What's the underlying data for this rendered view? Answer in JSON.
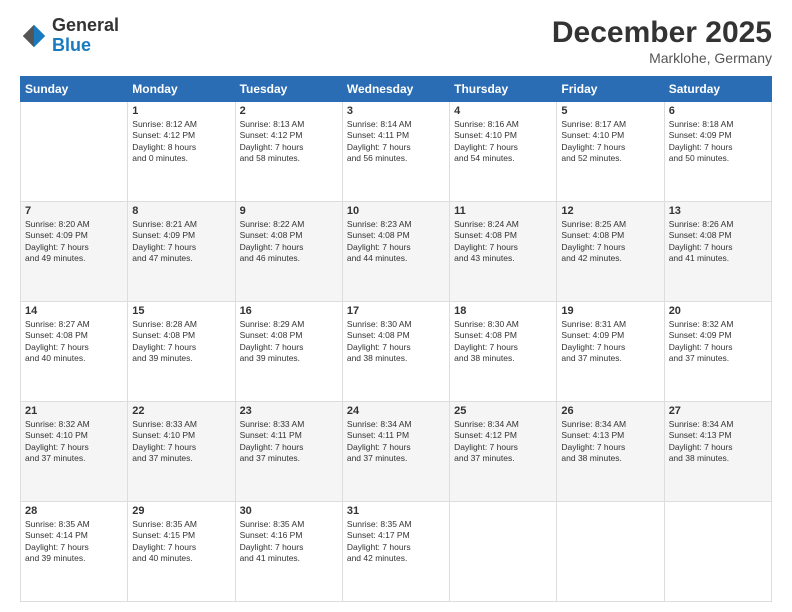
{
  "header": {
    "logo": {
      "general": "General",
      "blue": "Blue"
    },
    "title": "December 2025",
    "location": "Marklohe, Germany"
  },
  "days_of_week": [
    "Sunday",
    "Monday",
    "Tuesday",
    "Wednesday",
    "Thursday",
    "Friday",
    "Saturday"
  ],
  "weeks": [
    [
      {
        "day": "",
        "info": ""
      },
      {
        "day": "1",
        "info": "Sunrise: 8:12 AM\nSunset: 4:12 PM\nDaylight: 8 hours\nand 0 minutes."
      },
      {
        "day": "2",
        "info": "Sunrise: 8:13 AM\nSunset: 4:12 PM\nDaylight: 7 hours\nand 58 minutes."
      },
      {
        "day": "3",
        "info": "Sunrise: 8:14 AM\nSunset: 4:11 PM\nDaylight: 7 hours\nand 56 minutes."
      },
      {
        "day": "4",
        "info": "Sunrise: 8:16 AM\nSunset: 4:10 PM\nDaylight: 7 hours\nand 54 minutes."
      },
      {
        "day": "5",
        "info": "Sunrise: 8:17 AM\nSunset: 4:10 PM\nDaylight: 7 hours\nand 52 minutes."
      },
      {
        "day": "6",
        "info": "Sunrise: 8:18 AM\nSunset: 4:09 PM\nDaylight: 7 hours\nand 50 minutes."
      }
    ],
    [
      {
        "day": "7",
        "info": "Sunrise: 8:20 AM\nSunset: 4:09 PM\nDaylight: 7 hours\nand 49 minutes."
      },
      {
        "day": "8",
        "info": "Sunrise: 8:21 AM\nSunset: 4:09 PM\nDaylight: 7 hours\nand 47 minutes."
      },
      {
        "day": "9",
        "info": "Sunrise: 8:22 AM\nSunset: 4:08 PM\nDaylight: 7 hours\nand 46 minutes."
      },
      {
        "day": "10",
        "info": "Sunrise: 8:23 AM\nSunset: 4:08 PM\nDaylight: 7 hours\nand 44 minutes."
      },
      {
        "day": "11",
        "info": "Sunrise: 8:24 AM\nSunset: 4:08 PM\nDaylight: 7 hours\nand 43 minutes."
      },
      {
        "day": "12",
        "info": "Sunrise: 8:25 AM\nSunset: 4:08 PM\nDaylight: 7 hours\nand 42 minutes."
      },
      {
        "day": "13",
        "info": "Sunrise: 8:26 AM\nSunset: 4:08 PM\nDaylight: 7 hours\nand 41 minutes."
      }
    ],
    [
      {
        "day": "14",
        "info": "Sunrise: 8:27 AM\nSunset: 4:08 PM\nDaylight: 7 hours\nand 40 minutes."
      },
      {
        "day": "15",
        "info": "Sunrise: 8:28 AM\nSunset: 4:08 PM\nDaylight: 7 hours\nand 39 minutes."
      },
      {
        "day": "16",
        "info": "Sunrise: 8:29 AM\nSunset: 4:08 PM\nDaylight: 7 hours\nand 39 minutes."
      },
      {
        "day": "17",
        "info": "Sunrise: 8:30 AM\nSunset: 4:08 PM\nDaylight: 7 hours\nand 38 minutes."
      },
      {
        "day": "18",
        "info": "Sunrise: 8:30 AM\nSunset: 4:08 PM\nDaylight: 7 hours\nand 38 minutes."
      },
      {
        "day": "19",
        "info": "Sunrise: 8:31 AM\nSunset: 4:09 PM\nDaylight: 7 hours\nand 37 minutes."
      },
      {
        "day": "20",
        "info": "Sunrise: 8:32 AM\nSunset: 4:09 PM\nDaylight: 7 hours\nand 37 minutes."
      }
    ],
    [
      {
        "day": "21",
        "info": "Sunrise: 8:32 AM\nSunset: 4:10 PM\nDaylight: 7 hours\nand 37 minutes."
      },
      {
        "day": "22",
        "info": "Sunrise: 8:33 AM\nSunset: 4:10 PM\nDaylight: 7 hours\nand 37 minutes."
      },
      {
        "day": "23",
        "info": "Sunrise: 8:33 AM\nSunset: 4:11 PM\nDaylight: 7 hours\nand 37 minutes."
      },
      {
        "day": "24",
        "info": "Sunrise: 8:34 AM\nSunset: 4:11 PM\nDaylight: 7 hours\nand 37 minutes."
      },
      {
        "day": "25",
        "info": "Sunrise: 8:34 AM\nSunset: 4:12 PM\nDaylight: 7 hours\nand 37 minutes."
      },
      {
        "day": "26",
        "info": "Sunrise: 8:34 AM\nSunset: 4:13 PM\nDaylight: 7 hours\nand 38 minutes."
      },
      {
        "day": "27",
        "info": "Sunrise: 8:34 AM\nSunset: 4:13 PM\nDaylight: 7 hours\nand 38 minutes."
      }
    ],
    [
      {
        "day": "28",
        "info": "Sunrise: 8:35 AM\nSunset: 4:14 PM\nDaylight: 7 hours\nand 39 minutes."
      },
      {
        "day": "29",
        "info": "Sunrise: 8:35 AM\nSunset: 4:15 PM\nDaylight: 7 hours\nand 40 minutes."
      },
      {
        "day": "30",
        "info": "Sunrise: 8:35 AM\nSunset: 4:16 PM\nDaylight: 7 hours\nand 41 minutes."
      },
      {
        "day": "31",
        "info": "Sunrise: 8:35 AM\nSunset: 4:17 PM\nDaylight: 7 hours\nand 42 minutes."
      },
      {
        "day": "",
        "info": ""
      },
      {
        "day": "",
        "info": ""
      },
      {
        "day": "",
        "info": ""
      }
    ]
  ]
}
